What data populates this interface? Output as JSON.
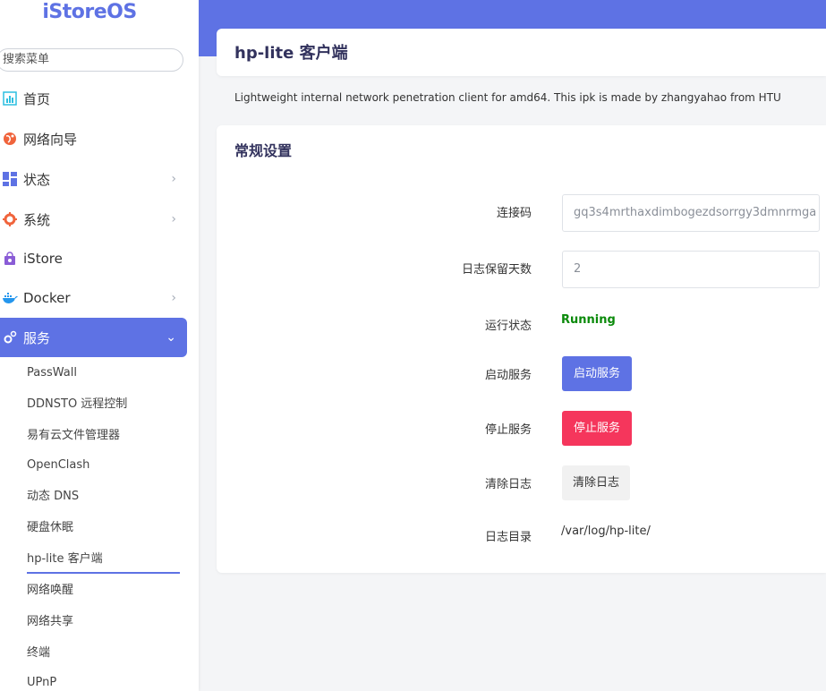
{
  "sidebar": {
    "logo": "iStoreOS",
    "search_placeholder": "搜索菜单",
    "items": [
      {
        "label": "首页",
        "icon": "home-chart-icon"
      },
      {
        "label": "网络向导",
        "icon": "globe-icon"
      },
      {
        "label": "状态",
        "icon": "dashboard-icon"
      },
      {
        "label": "系统",
        "icon": "gear-icon"
      },
      {
        "label": "iStore",
        "icon": "store-bag-icon"
      },
      {
        "label": "Docker",
        "icon": "docker-whale-icon"
      },
      {
        "label": "服务",
        "icon": "services-gears-icon"
      }
    ],
    "sub_items": [
      "PassWall",
      "DDNSTO 远程控制",
      "易有云文件管理器",
      "OpenClash",
      "动态 DNS",
      "硬盘休眠",
      "hp-lite 客户端",
      "网络唤醒",
      "网络共享",
      "终端",
      "UPnP"
    ]
  },
  "page": {
    "title": "hp-lite 客户端",
    "description": "Lightweight internal network penetration client for amd64. This ipk is made by zhangyahao from HTU"
  },
  "settings": {
    "section_title": "常规设置",
    "conn_code_label": "连接码",
    "conn_code_value": "gq3s4mrthaxdimbogezdsorrgy3dmnrmga",
    "log_days_label": "日志保留天数",
    "log_days_value": "2",
    "run_status_label": "运行状态",
    "run_status_value": "Running",
    "start_label": "启动服务",
    "start_button": "启动服务",
    "stop_label": "停止服务",
    "stop_button": "停止服务",
    "clear_label": "清除日志",
    "clear_button": "清除日志",
    "log_dir_label": "日志目录",
    "log_dir_value": "/var/log/hp-lite/"
  },
  "colors": {
    "accent": "#5e72e4",
    "danger": "#f5365c",
    "running": "#0a8a0a"
  }
}
